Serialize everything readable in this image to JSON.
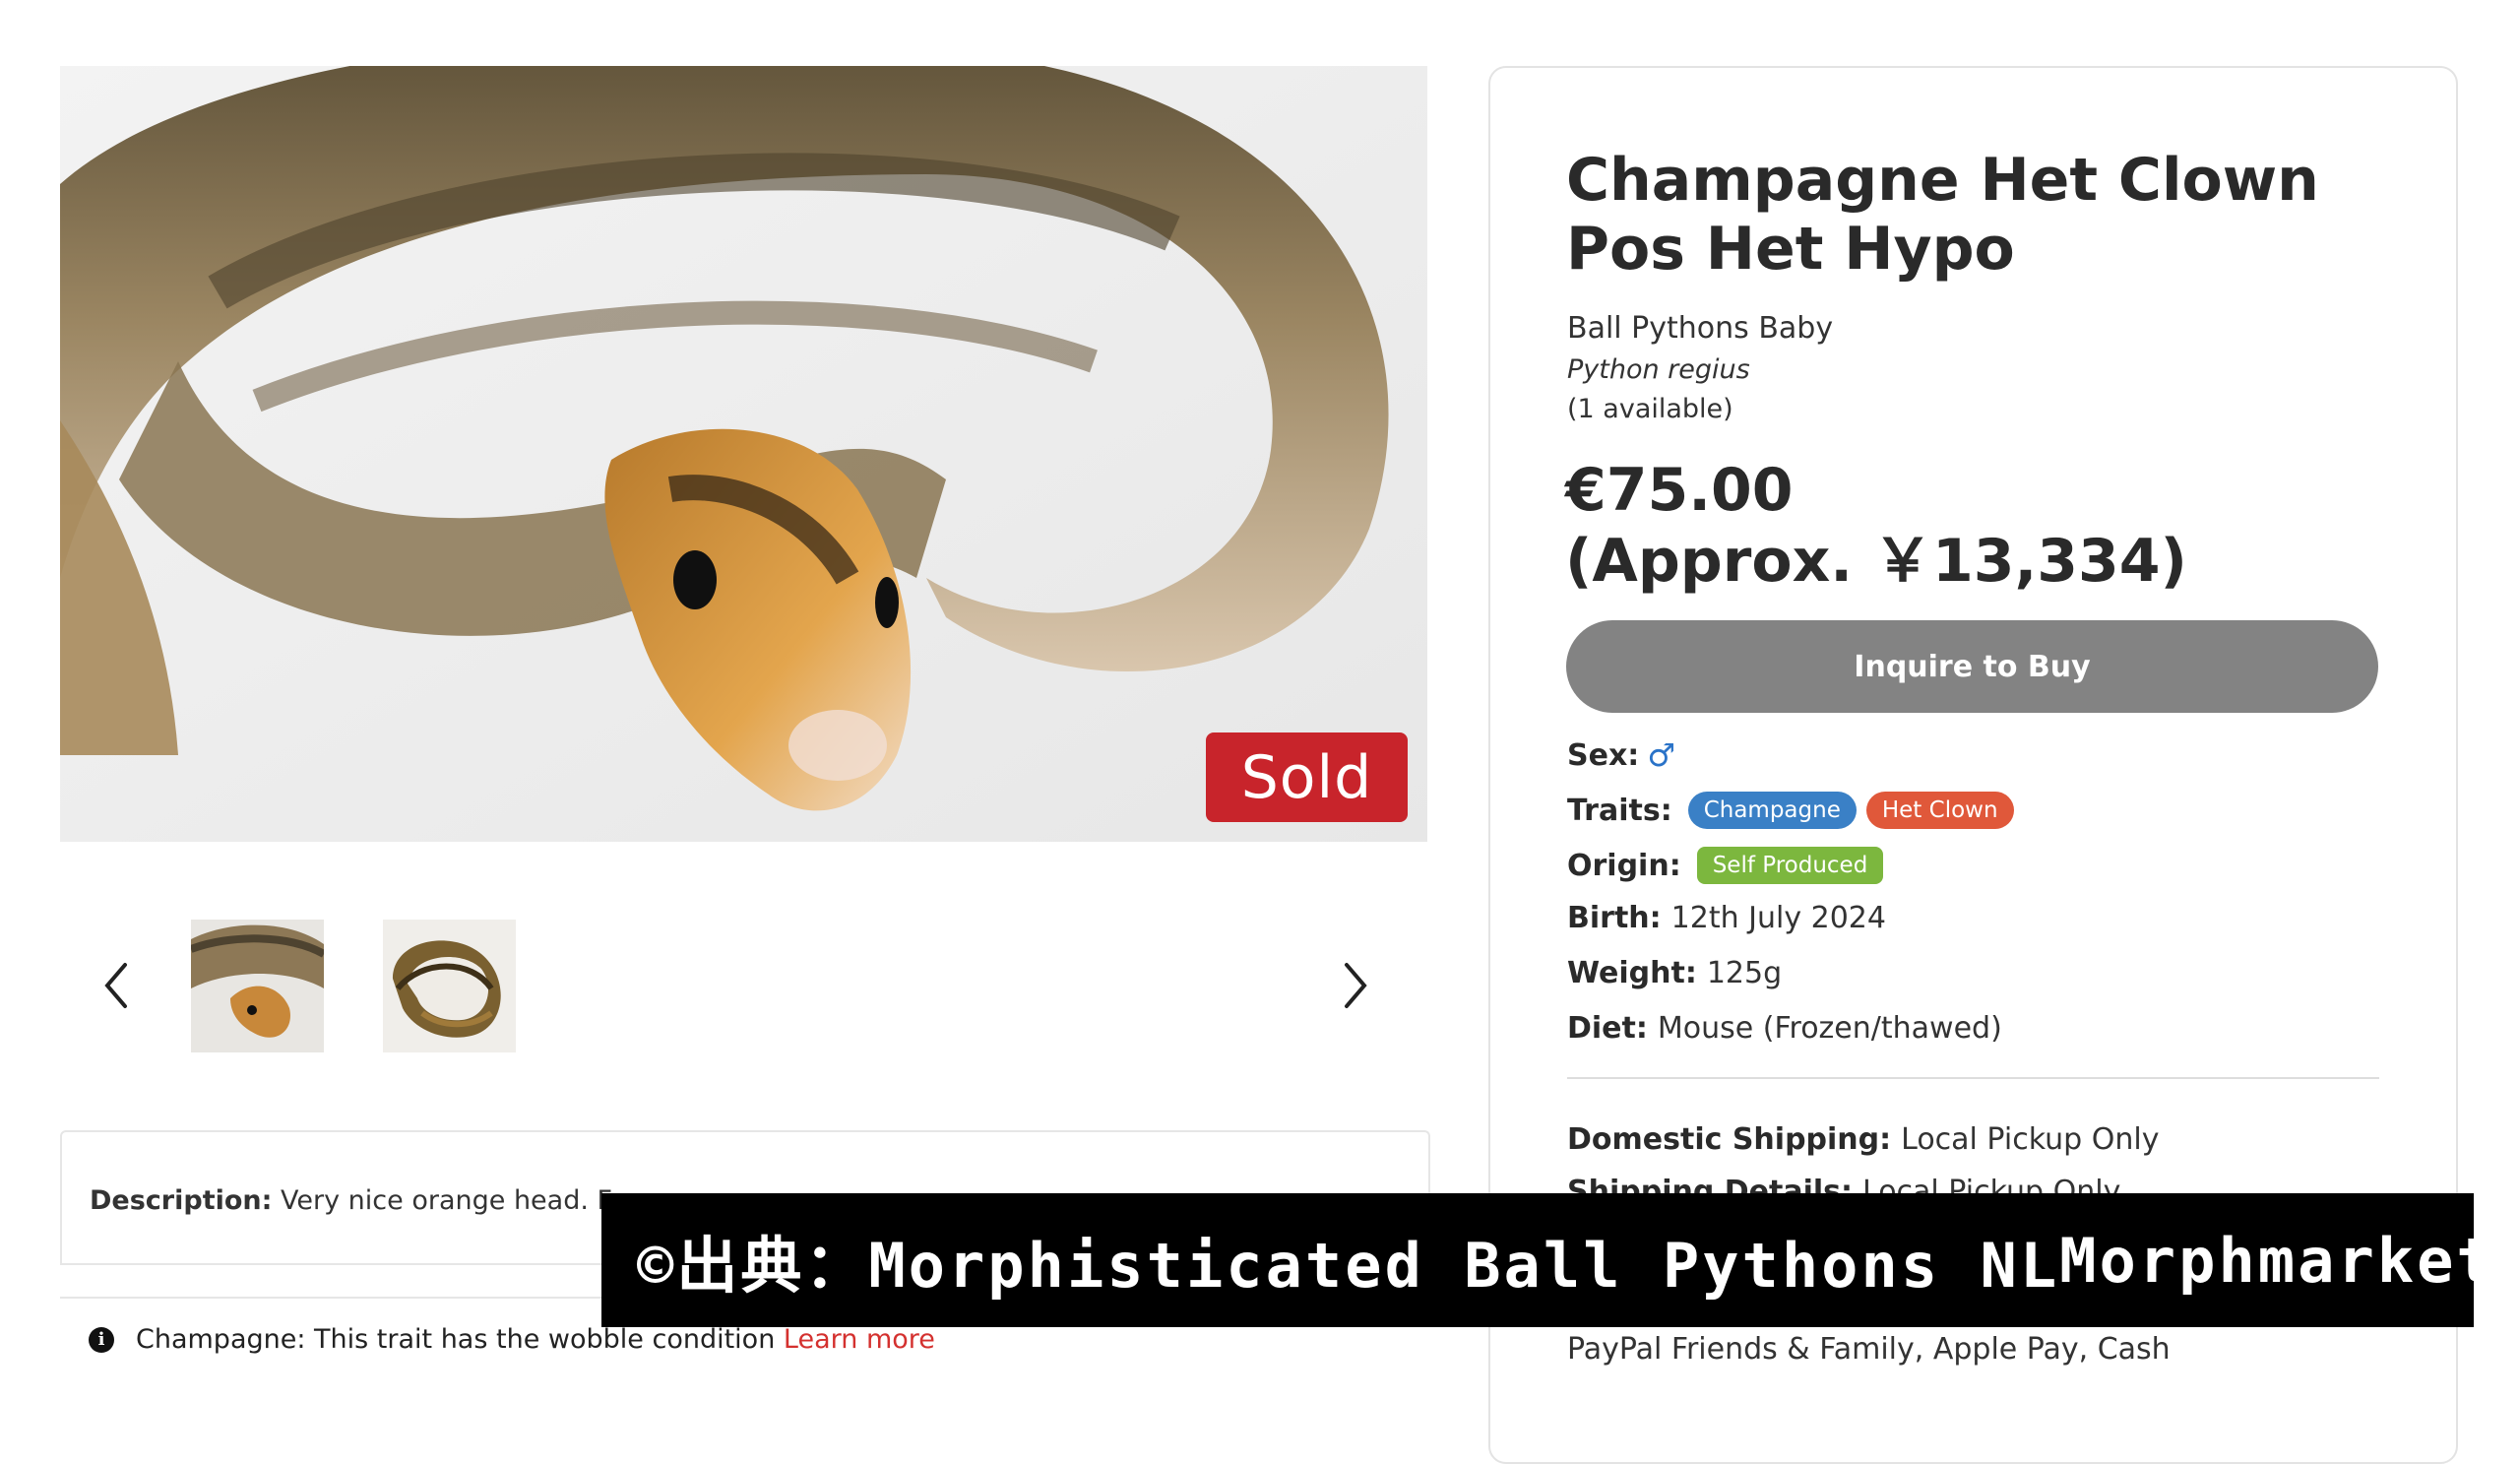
{
  "listing": {
    "title": "Champagne Het Clown Pos Het Hypo",
    "category": "Ball Pythons Baby",
    "species": "Python regius",
    "availability": "(1 available)",
    "price_eur": "€75.00",
    "price_approx": "(Approx. ￥13,334)",
    "sold_badge": "Sold",
    "inquire_label": "Inquire to Buy"
  },
  "gallery": {
    "thumbnail_count": 2
  },
  "details": {
    "sex_label": "Sex:",
    "sex_value": "♂",
    "traits_label": "Traits:",
    "traits": [
      {
        "name": "Champagne",
        "color": "#3a80c6"
      },
      {
        "name": "Het Clown",
        "color": "#e0583a"
      }
    ],
    "origin_label": "Origin:",
    "origin_value": "Self Produced",
    "origin_color": "#7cb73e",
    "birth_label": "Birth:",
    "birth_value": "12th July 2024",
    "weight_label": "Weight:",
    "weight_value": "125g",
    "diet_label": "Diet:",
    "diet_value": "Mouse (Frozen/thawed)"
  },
  "shipping": {
    "domestic_label": "Domestic Shipping:",
    "domestic_value": "Local Pickup Only",
    "details_label": "Shipping Details:",
    "details_value": "Local Pickup Only",
    "payment_methods": "PayPal Friends & Family, Apple Pay, Cash"
  },
  "description": {
    "label": "Description:",
    "text": "Very nice orange head. Free"
  },
  "trait_note": {
    "text": "Champagne: This trait has the wobble condition",
    "link": "Learn more"
  },
  "watermark": {
    "credit": "©出典：Morphisticated Ball Pythons NL",
    "site": "Morphmarket"
  }
}
